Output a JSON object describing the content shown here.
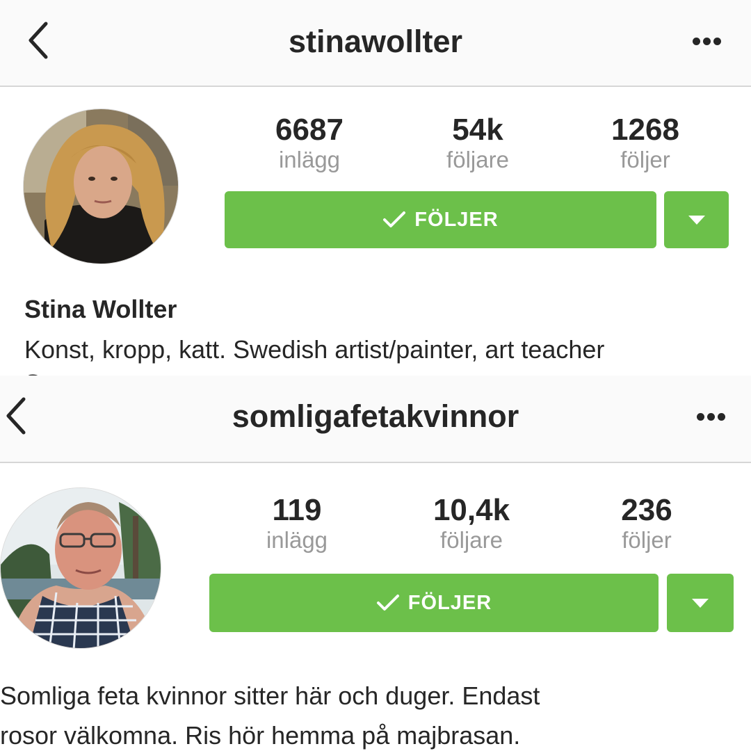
{
  "colors": {
    "accent_green": "#6cc04a",
    "text_primary": "#262626",
    "text_secondary": "#999999",
    "navbar_bg": "#fafafa"
  },
  "icons": {
    "back": "chevron-left-icon",
    "more": "more-horizontal-icon",
    "check": "checkmark-icon",
    "dropdown": "caret-down-icon"
  },
  "profiles": [
    {
      "username": "stinawollter",
      "stats": [
        {
          "value": "6687",
          "label": "inlägg"
        },
        {
          "value": "54k",
          "label": "följare"
        },
        {
          "value": "1268",
          "label": "följer"
        }
      ],
      "follow_label": "FÖLJER",
      "full_name": "Stina Wollter",
      "bio": [
        "Konst, kropp, katt. Swedish artist/painter, art teacher",
        "S"
      ]
    },
    {
      "username": "somligafetakvinnor",
      "stats": [
        {
          "value": "119",
          "label": "inlägg"
        },
        {
          "value": "10,4k",
          "label": "följare"
        },
        {
          "value": "236",
          "label": "följer"
        }
      ],
      "follow_label": "FÖLJER",
      "bio": [
        "Somliga feta kvinnor sitter här och duger. Endast",
        "rosor välkomna. Ris hör hemma på majbrasan."
      ]
    }
  ]
}
